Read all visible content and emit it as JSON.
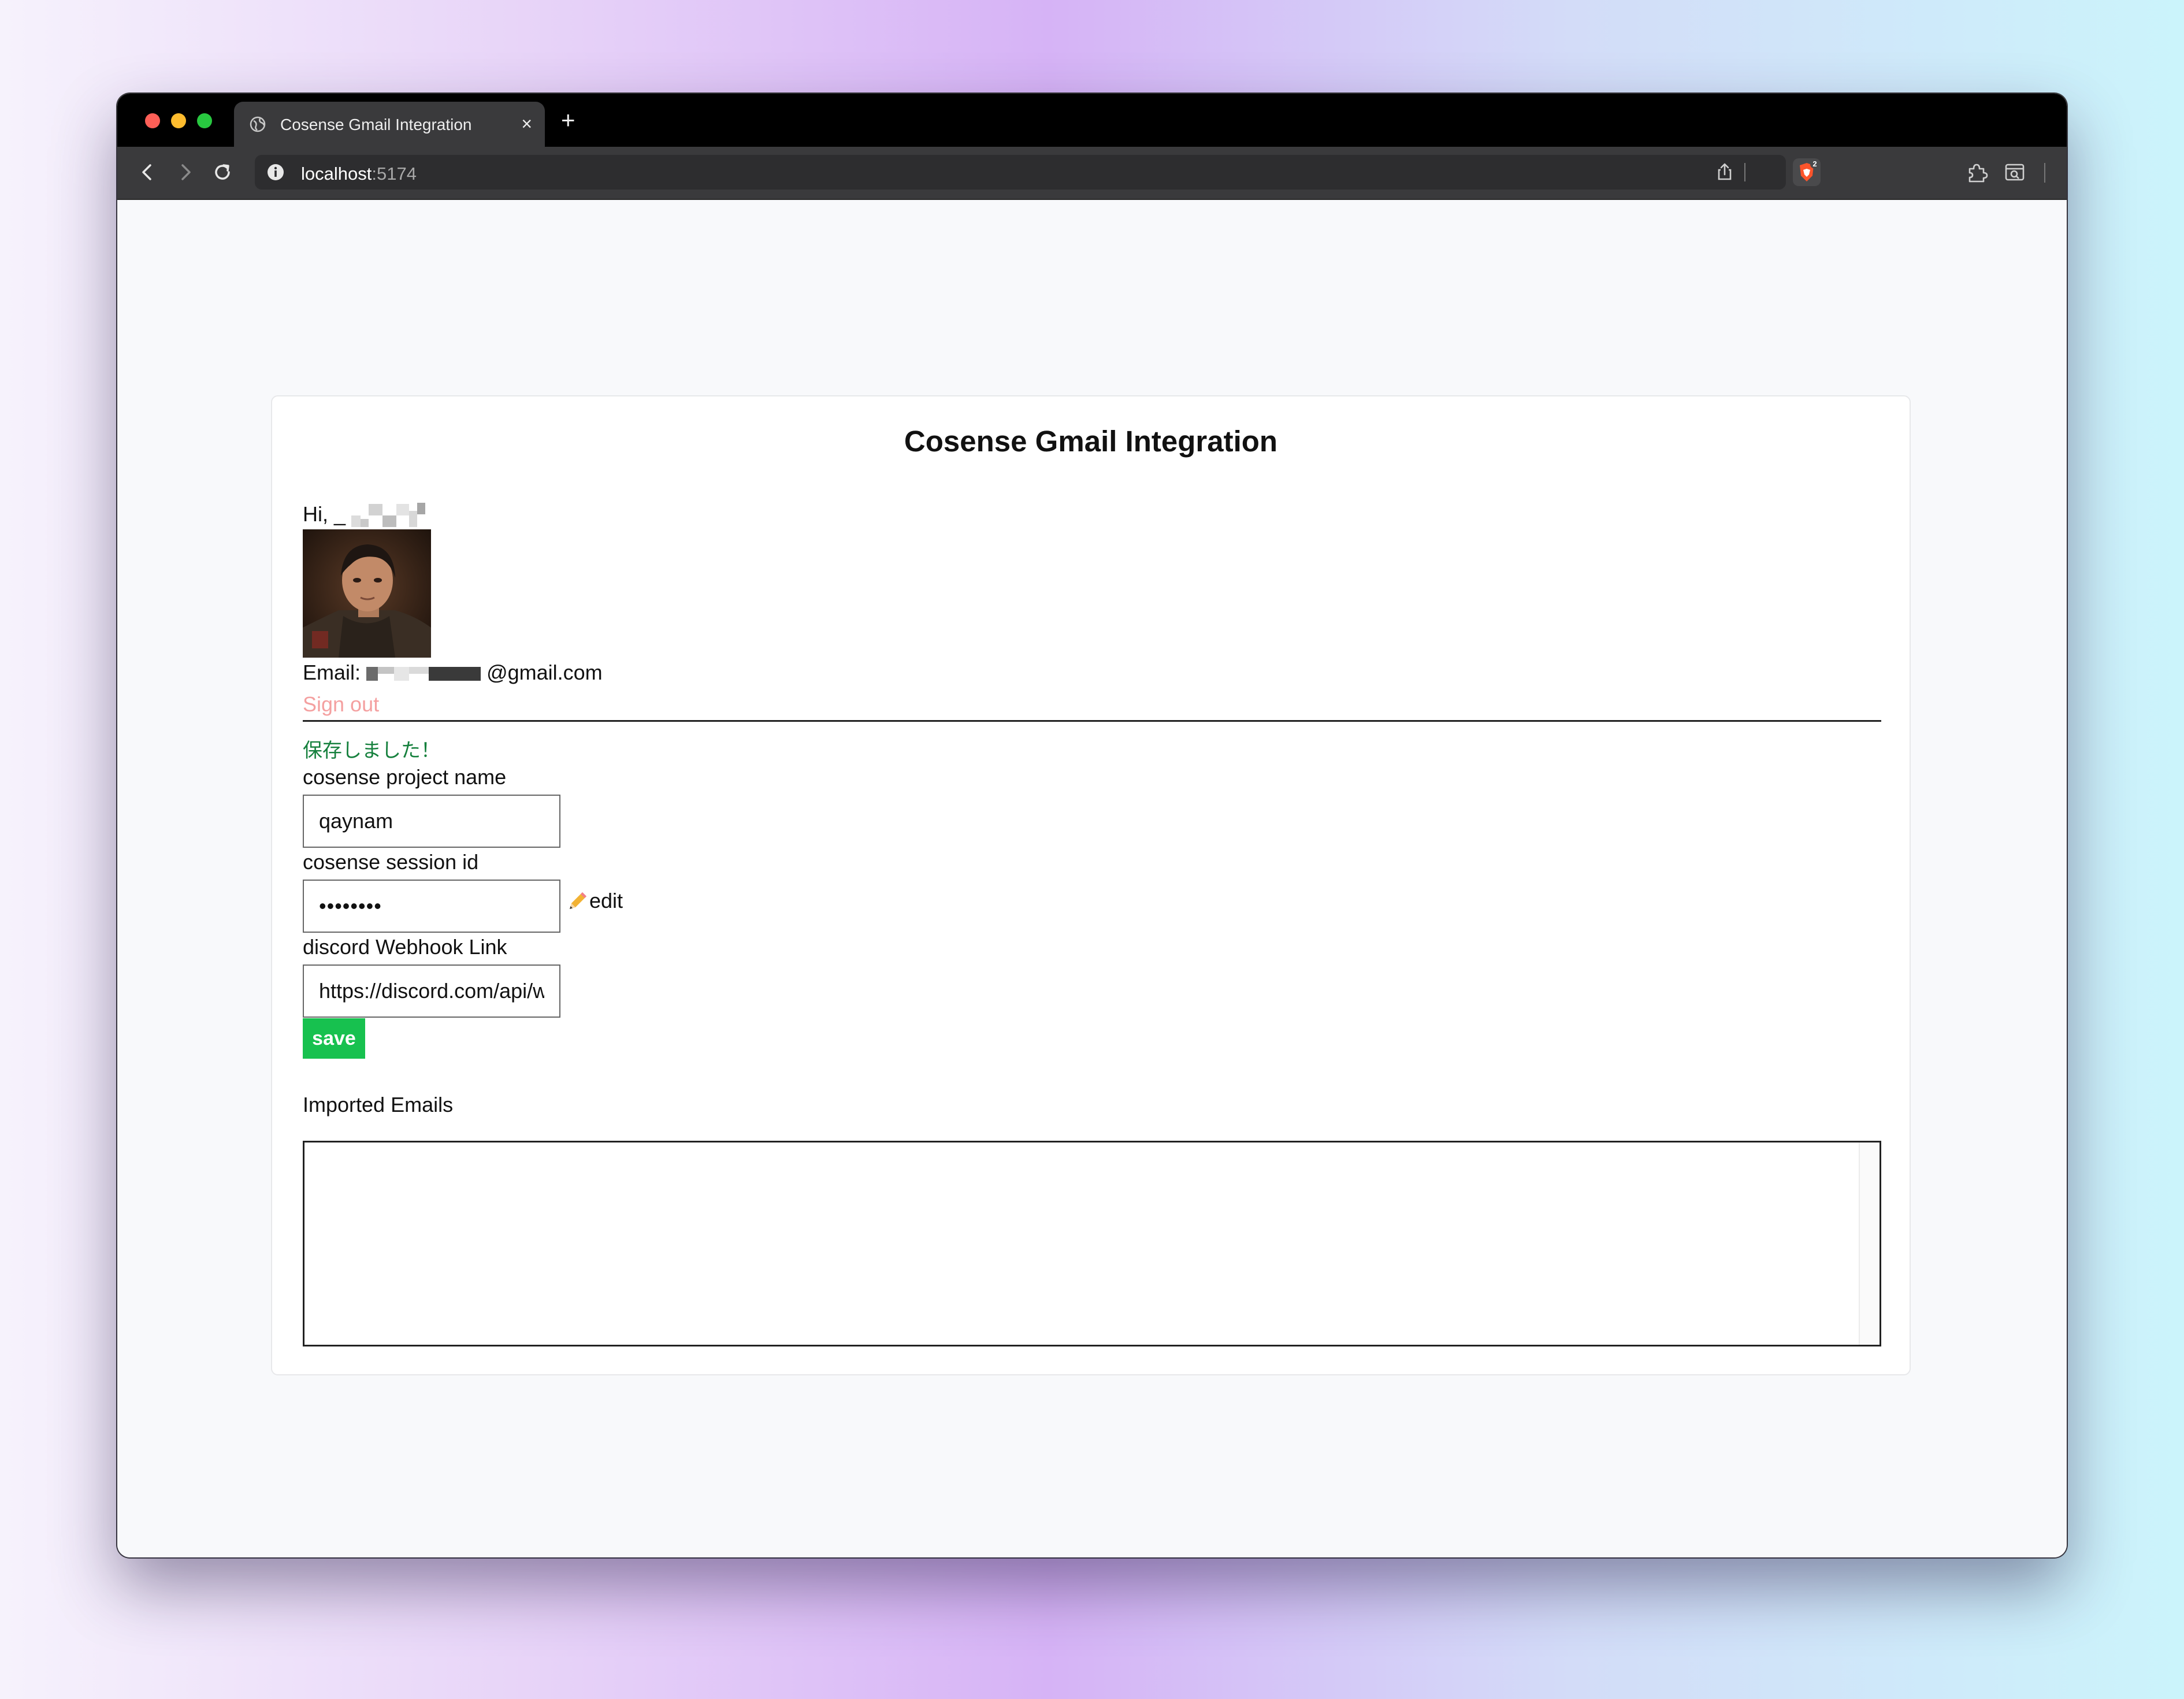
{
  "browser": {
    "tab_title": "Cosense Gmail Integration",
    "tab_close": "×",
    "new_tab": "+",
    "url_host": "localhost",
    "url_port": ":5174",
    "shields_badge": "2"
  },
  "page": {
    "title": "Cosense Gmail Integration",
    "greeting": "Hi, _",
    "email_label": "Email:",
    "email_suffix": "@gmail.com",
    "sign_out": "Sign out",
    "saved_message": "保存しました！",
    "project_name_label": "cosense project name",
    "project_name_value": "qaynam",
    "session_id_label": "cosense session id",
    "session_id_value": "••••••••",
    "edit_label": "edit",
    "webhook_label": "discord Webhook Link",
    "webhook_value": "https://discord.com/api/webhooks",
    "save_label": "save",
    "imported_emails_label": "Imported Emails"
  },
  "colors": {
    "save_button": "#17c14f",
    "saved_message": "#15803d",
    "sign_out": "#f4a0a0"
  },
  "icons": [
    "globe-icon",
    "back-icon",
    "forward-icon",
    "reload-icon",
    "info-icon",
    "share-icon",
    "brave-shields-icon",
    "extensions-icon",
    "screenshot-icon",
    "sidebar-icon",
    "leo-ai-icon",
    "menu-icon",
    "pencil-icon"
  ]
}
